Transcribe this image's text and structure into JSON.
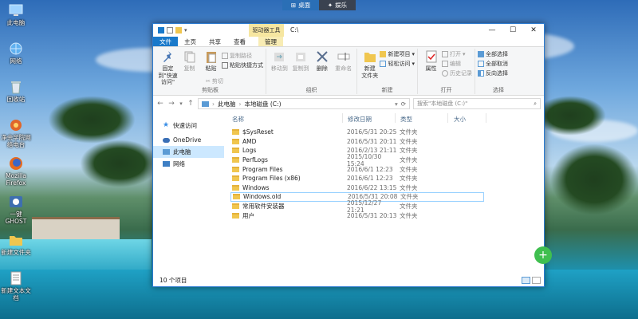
{
  "desktop": {
    "icons": [
      {
        "label": "此电脑",
        "icon": "computer-icon"
      },
      {
        "label": "网络",
        "icon": "network-icon"
      },
      {
        "label": "回收站",
        "icon": "recycle-bin-icon"
      },
      {
        "label": "净余学院网络电台",
        "icon": "radio-app-icon"
      },
      {
        "label": "Mozilla Firefox",
        "icon": "firefox-icon"
      },
      {
        "label": "一键GHOST",
        "icon": "ghost-icon"
      },
      {
        "label": "新建文件夹",
        "icon": "folder-icon"
      },
      {
        "label": "新建文本文档",
        "icon": "text-document-icon"
      }
    ],
    "switcher": {
      "desktop_label": "桌面",
      "entertain_label": "娱乐"
    }
  },
  "window": {
    "context_tab": "驱动器工具",
    "title": "C:\\",
    "tabs": [
      "文件",
      "主页",
      "共享",
      "查看",
      "管理"
    ],
    "ribbon": {
      "clipboard": {
        "name": "剪贴板",
        "pin": "固定到\"快速访问\"",
        "copy": "复制",
        "paste": "粘贴",
        "cut": "剪切",
        "copy_path": "复制路径",
        "paste_shortcut": "粘贴快捷方式"
      },
      "organize": {
        "name": "组织",
        "move_to": "移动到",
        "copy_to": "复制到",
        "delete": "删除",
        "rename": "重命名"
      },
      "new": {
        "name": "新建",
        "new_folder": "新建\n文件夹",
        "new_item": "新建项目",
        "easy_access": "轻松访问"
      },
      "open": {
        "name": "打开",
        "properties": "属性",
        "open": "打开",
        "edit": "编辑",
        "history": "历史记录"
      },
      "select": {
        "name": "选择",
        "select_all": "全部选择",
        "select_none": "全部取消",
        "invert": "反向选择"
      }
    },
    "address": {
      "path": [
        "此电脑",
        "本地磁盘 (C:)"
      ],
      "search_placeholder": "搜索\"本地磁盘 (C:)\""
    },
    "nav": [
      {
        "label": "快速访问",
        "icon": "star-icon"
      },
      {
        "label": "OneDrive",
        "icon": "cloud-icon"
      },
      {
        "label": "此电脑",
        "icon": "computer-icon"
      },
      {
        "label": "网络",
        "icon": "network-icon"
      }
    ],
    "columns": {
      "name": "名称",
      "date": "修改日期",
      "type": "类型",
      "size": "大小"
    },
    "files": [
      {
        "name": "$SysReset",
        "date": "2016/5/31 20:25",
        "type": "文件夹"
      },
      {
        "name": "AMD",
        "date": "2016/5/31 20:11",
        "type": "文件夹"
      },
      {
        "name": "Logs",
        "date": "2016/2/13 21:11",
        "type": "文件夹"
      },
      {
        "name": "PerfLogs",
        "date": "2015/10/30 15:24",
        "type": "文件夹"
      },
      {
        "name": "Program Files",
        "date": "2016/6/1 12:23",
        "type": "文件夹"
      },
      {
        "name": "Program Files (x86)",
        "date": "2016/6/1 12:23",
        "type": "文件夹"
      },
      {
        "name": "Windows",
        "date": "2016/6/22 13:15",
        "type": "文件夹"
      },
      {
        "name": "Windows.old",
        "date": "2016/5/31 20:08",
        "type": "文件夹"
      },
      {
        "name": "常用软件安装器",
        "date": "2015/12/27 21:21",
        "type": "文件夹"
      },
      {
        "name": "用户",
        "date": "2016/5/31 20:13",
        "type": "文件夹"
      }
    ],
    "status": "10 个项目"
  }
}
